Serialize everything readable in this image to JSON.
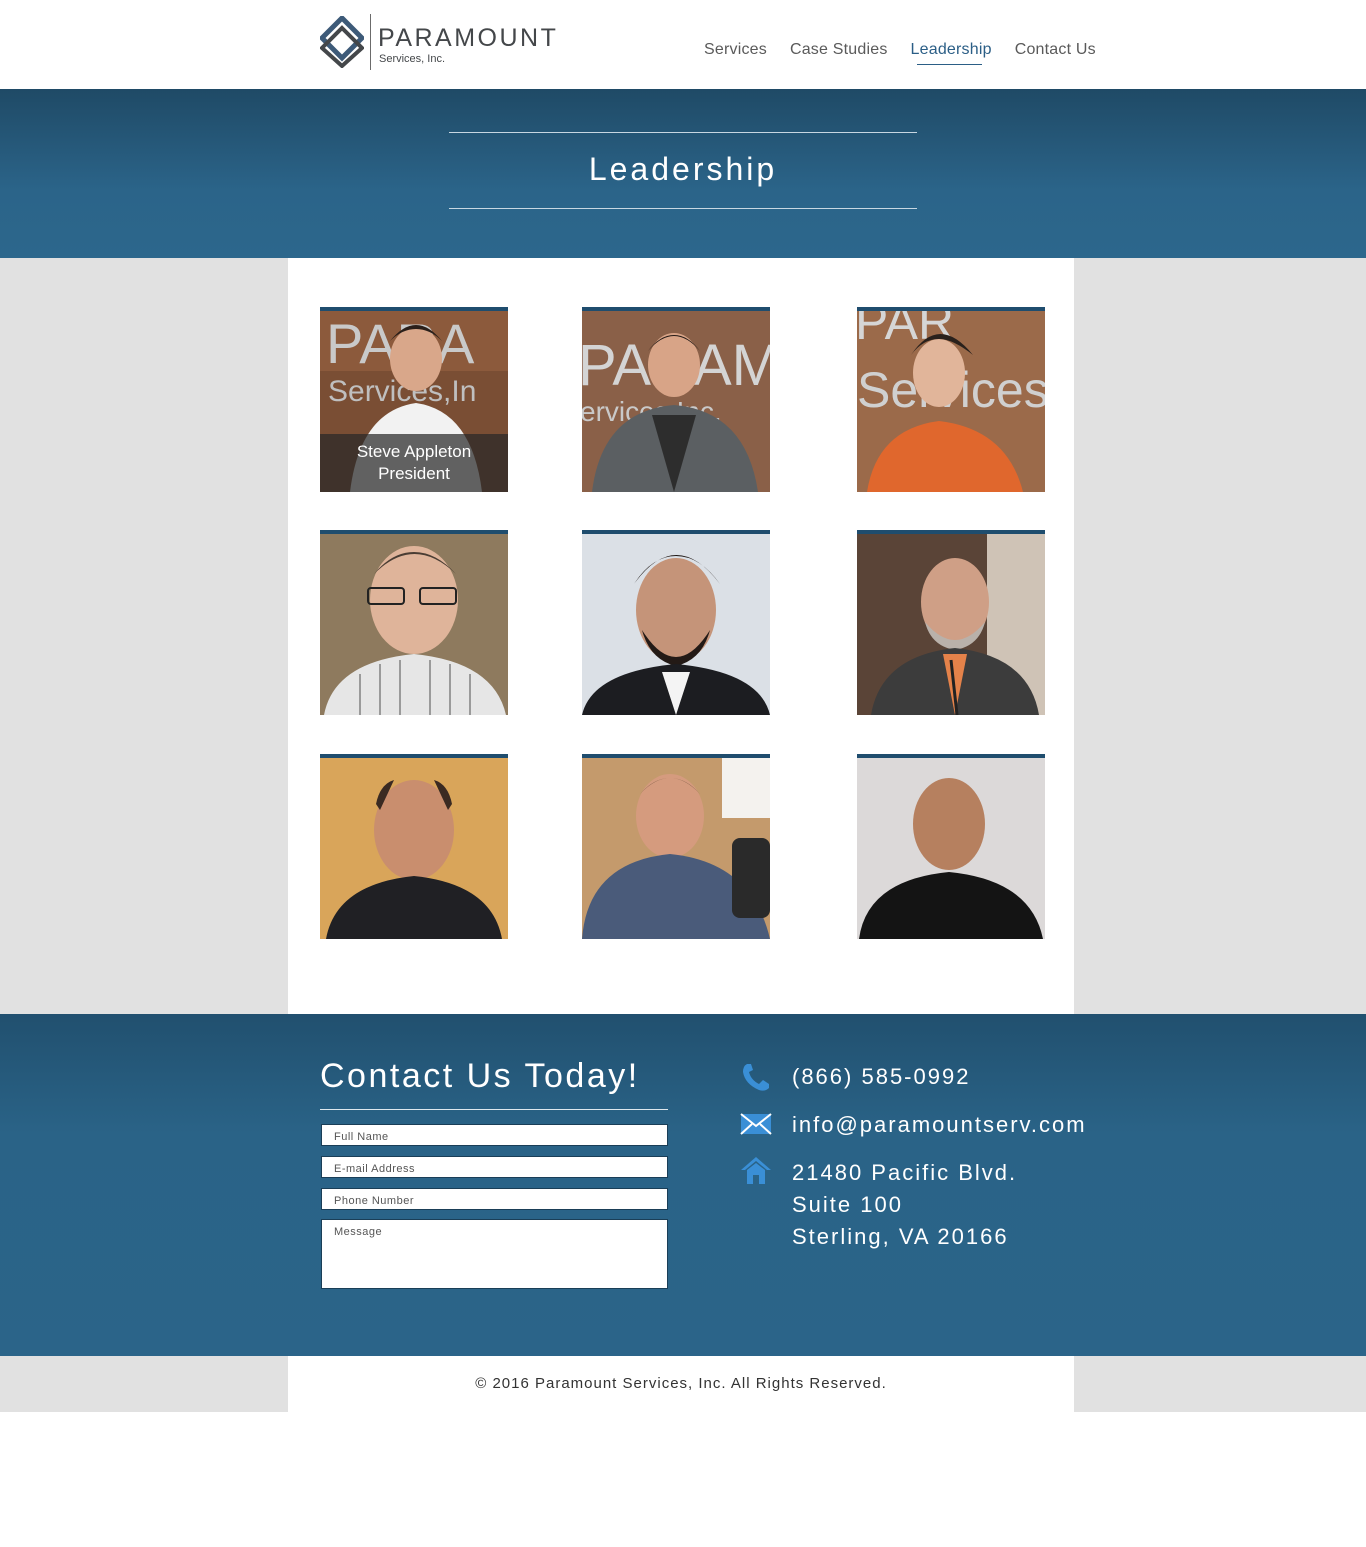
{
  "brand": {
    "name": "PARAMOUNT",
    "subtitle": "Services, Inc."
  },
  "nav": {
    "items": [
      {
        "label": "Services"
      },
      {
        "label": "Case Studies"
      },
      {
        "label": "Leadership"
      },
      {
        "label": "Contact Us"
      }
    ],
    "active": "Leadership"
  },
  "page": {
    "title": "Leadership"
  },
  "team": [
    {
      "name": "Steve Appleton",
      "role": "President"
    },
    {
      "name": "",
      "role": ""
    },
    {
      "name": "",
      "role": ""
    },
    {
      "name": "",
      "role": ""
    },
    {
      "name": "",
      "role": ""
    },
    {
      "name": "",
      "role": ""
    },
    {
      "name": "",
      "role": ""
    },
    {
      "name": "",
      "role": ""
    },
    {
      "name": "",
      "role": ""
    }
  ],
  "contact": {
    "title": "Contact Us Today!",
    "form": {
      "full_name_placeholder": "Full Name",
      "email_placeholder": "E-mail Address",
      "phone_placeholder": "Phone Number",
      "message_placeholder": "Message"
    },
    "phone": "(866) 585-0992",
    "email": "info@paramountserv.com",
    "address": {
      "line1": "21480 Pacific Blvd.",
      "line2": "Suite 100",
      "line3": "Sterling, VA 20166"
    },
    "icons": [
      "phone-icon",
      "mail-icon",
      "home-icon"
    ]
  },
  "footer": {
    "copyright": "© 2016 Paramount Services, Inc. All Rights Reserved."
  },
  "colors": {
    "brand_blue": "#2b6489",
    "dark_blue": "#1f4a66",
    "icon_blue": "#3a8fd6",
    "page_gray": "#e1e1e1"
  }
}
